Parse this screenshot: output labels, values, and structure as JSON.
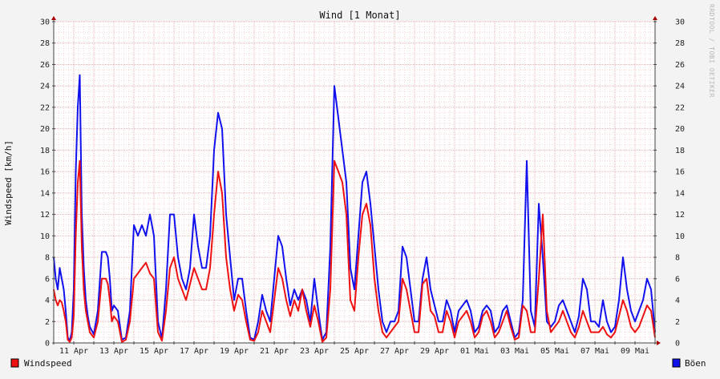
{
  "chart_data": {
    "type": "line",
    "title": "Wind [1 Monat]",
    "ylabel": "Windspeed [km/h]",
    "ylim": [
      0,
      30
    ],
    "y_ticks": [
      0,
      2,
      4,
      6,
      8,
      10,
      12,
      14,
      16,
      18,
      20,
      22,
      24,
      26,
      28,
      30
    ],
    "y_tick_labels": [
      "0",
      "2",
      "4",
      "6",
      "8",
      "10",
      "12",
      "14",
      "16",
      "18",
      "20",
      "22",
      "24",
      "26",
      "28",
      "30"
    ],
    "x_unit": "day",
    "xlim": [
      0,
      30
    ],
    "x_ticks": [
      1,
      3,
      5,
      7,
      9,
      11,
      13,
      15,
      17,
      19,
      21,
      23,
      25,
      27,
      29
    ],
    "x_tick_labels": [
      "11 Apr",
      "13 Apr",
      "15 Apr",
      "17 Apr",
      "19 Apr",
      "21 Apr",
      "23 Apr",
      "25 Apr",
      "27 Apr",
      "29 Apr",
      "01 Mai",
      "03 Mai",
      "05 Mai",
      "07 Mai",
      "09 Mai"
    ],
    "grid": true,
    "watermark": "RRDTOOL / TOBI OETIKER",
    "colors": {
      "windspeed": "#ee1111",
      "gusts": "#1111ee",
      "grid": "#e8a8a8",
      "background": "#ffffff"
    },
    "series": [
      {
        "name": "Windspeed",
        "color": "#ee1111",
        "x": [
          0,
          0.1,
          0.2,
          0.3,
          0.4,
          0.5,
          0.6,
          0.7,
          0.8,
          0.9,
          1.0,
          1.1,
          1.2,
          1.3,
          1.4,
          1.5,
          1.6,
          1.7,
          1.8,
          2.0,
          2.2,
          2.4,
          2.6,
          2.7,
          2.8,
          2.9,
          3.0,
          3.2,
          3.4,
          3.6,
          3.8,
          4.0,
          4.2,
          4.4,
          4.6,
          4.8,
          5.0,
          5.2,
          5.4,
          5.6,
          5.8,
          6.0,
          6.2,
          6.4,
          6.6,
          6.8,
          7.0,
          7.2,
          7.4,
          7.6,
          7.8,
          8.0,
          8.2,
          8.4,
          8.6,
          8.8,
          9.0,
          9.2,
          9.4,
          9.6,
          9.8,
          10.0,
          10.2,
          10.4,
          10.6,
          10.8,
          11.0,
          11.2,
          11.4,
          11.6,
          11.8,
          12.0,
          12.2,
          12.4,
          12.6,
          12.8,
          13.0,
          13.2,
          13.4,
          13.6,
          13.8,
          14.0,
          14.2,
          14.4,
          14.6,
          14.8,
          15.0,
          15.2,
          15.4,
          15.6,
          15.8,
          16.0,
          16.2,
          16.4,
          16.6,
          16.8,
          17.0,
          17.2,
          17.4,
          17.6,
          17.8,
          18.0,
          18.2,
          18.4,
          18.6,
          18.8,
          19.0,
          19.2,
          19.4,
          19.6,
          19.8,
          20.0,
          20.2,
          20.4,
          20.6,
          20.8,
          21.0,
          21.2,
          21.4,
          21.6,
          21.8,
          22.0,
          22.2,
          22.4,
          22.6,
          22.8,
          23.0,
          23.2,
          23.4,
          23.6,
          23.8,
          24.0,
          24.2,
          24.4,
          24.6,
          24.8,
          25.0,
          25.2,
          25.4,
          25.6,
          25.8,
          26.0,
          26.2,
          26.4,
          26.6,
          26.8,
          27.0,
          27.2,
          27.4,
          27.6,
          27.8,
          28.0,
          28.2,
          28.4,
          28.6,
          28.8,
          29.0,
          29.2,
          29.4,
          29.6,
          29.8,
          30.0
        ],
        "values": [
          5,
          4,
          3.5,
          4,
          3.8,
          3,
          2,
          0.3,
          0.1,
          0.5,
          2.5,
          10,
          15,
          17,
          9,
          5,
          3,
          2,
          1,
          0.5,
          2,
          6,
          6,
          5.5,
          4,
          2,
          2.5,
          2,
          0.1,
          0.3,
          2,
          6,
          6.5,
          7,
          7.5,
          6.5,
          6,
          1,
          0.2,
          3,
          7,
          8,
          6,
          5,
          4,
          5.5,
          7,
          6,
          5,
          5,
          7,
          12,
          16,
          14,
          8,
          5,
          3,
          4.5,
          4,
          2,
          0.3,
          0.2,
          1,
          3,
          2,
          1,
          4,
          7,
          6,
          4,
          2.5,
          4,
          3,
          5,
          3,
          1.5,
          3.5,
          2,
          0.1,
          0.5,
          5,
          17,
          16,
          15,
          12,
          4,
          3,
          8,
          12,
          13,
          11,
          6,
          3,
          1,
          0.5,
          1,
          1.5,
          2,
          6,
          5,
          3,
          1,
          1,
          5.5,
          6,
          3,
          2.5,
          1,
          1,
          3,
          2,
          0.5,
          2,
          2.5,
          3,
          2,
          0.5,
          1,
          2.5,
          3,
          2,
          0.5,
          1,
          2,
          3,
          1.5,
          0.3,
          0.5,
          3.5,
          3,
          1,
          1,
          6,
          12,
          3,
          1,
          1.5,
          2,
          3,
          2,
          1,
          0.5,
          1.5,
          3,
          2,
          1,
          1,
          1,
          1.5,
          0.8,
          0.5,
          1,
          2.5,
          4,
          3,
          1.5,
          1,
          1.5,
          2.5,
          3.5,
          3,
          0.5
        ]
      },
      {
        "name": "Böen",
        "color": "#1111ee",
        "x": [
          0,
          0.1,
          0.2,
          0.3,
          0.4,
          0.5,
          0.6,
          0.7,
          0.8,
          0.9,
          1.0,
          1.1,
          1.2,
          1.3,
          1.4,
          1.5,
          1.6,
          1.7,
          1.8,
          2.0,
          2.2,
          2.4,
          2.6,
          2.7,
          2.8,
          2.9,
          3.0,
          3.2,
          3.4,
          3.6,
          3.8,
          4.0,
          4.2,
          4.4,
          4.6,
          4.8,
          5.0,
          5.2,
          5.4,
          5.6,
          5.8,
          6.0,
          6.2,
          6.4,
          6.6,
          6.8,
          7.0,
          7.2,
          7.4,
          7.6,
          7.8,
          8.0,
          8.2,
          8.4,
          8.6,
          8.8,
          9.0,
          9.2,
          9.4,
          9.6,
          9.8,
          10.0,
          10.2,
          10.4,
          10.6,
          10.8,
          11.0,
          11.2,
          11.4,
          11.6,
          11.8,
          12.0,
          12.2,
          12.4,
          12.6,
          12.8,
          13.0,
          13.2,
          13.4,
          13.6,
          13.8,
          14.0,
          14.2,
          14.4,
          14.6,
          14.8,
          15.0,
          15.2,
          15.4,
          15.6,
          15.8,
          16.0,
          16.2,
          16.4,
          16.6,
          16.8,
          17.0,
          17.2,
          17.4,
          17.6,
          17.8,
          18.0,
          18.2,
          18.4,
          18.6,
          18.8,
          19.0,
          19.2,
          19.4,
          19.6,
          19.8,
          20.0,
          20.2,
          20.4,
          20.6,
          20.8,
          21.0,
          21.2,
          21.4,
          21.6,
          21.8,
          22.0,
          22.2,
          22.4,
          22.6,
          22.8,
          23.0,
          23.2,
          23.4,
          23.6,
          23.8,
          24.0,
          24.2,
          24.4,
          24.6,
          24.8,
          25.0,
          25.2,
          25.4,
          25.6,
          25.8,
          26.0,
          26.2,
          26.4,
          26.6,
          26.8,
          27.0,
          27.2,
          27.4,
          27.6,
          27.8,
          28.0,
          28.2,
          28.4,
          28.6,
          28.8,
          29.0,
          29.2,
          29.4,
          29.6,
          29.8,
          30.0
        ],
        "values": [
          8,
          6,
          5,
          7,
          6,
          5,
          3,
          0.5,
          0.2,
          1,
          5,
          16,
          22,
          25,
          12,
          7,
          4,
          2.5,
          1.5,
          0.8,
          3,
          8.5,
          8.5,
          8,
          6,
          3,
          3.5,
          3,
          0.3,
          0.5,
          3,
          11,
          10,
          11,
          10,
          12,
          10,
          2,
          0.4,
          5,
          12,
          12,
          8,
          6,
          5,
          7,
          12,
          9,
          7,
          7,
          10,
          18,
          21.5,
          20,
          12,
          8,
          4,
          6,
          6,
          3,
          0.5,
          0.3,
          2,
          4.5,
          3,
          2,
          6,
          10,
          9,
          6,
          3.5,
          5,
          4,
          5,
          4,
          2,
          6,
          3,
          0.3,
          1,
          9,
          24,
          21,
          18,
          15,
          7,
          5,
          10,
          15,
          16,
          13,
          9,
          5,
          2,
          1,
          2,
          2,
          3,
          9,
          8,
          5,
          2,
          2,
          6,
          8,
          5,
          3.5,
          2,
          2,
          4,
          3,
          1,
          3,
          3.5,
          4,
          3,
          1,
          1.5,
          3,
          3.5,
          3,
          1,
          1.5,
          3,
          3.5,
          2,
          0.5,
          1,
          4,
          17,
          3,
          1.5,
          13,
          8,
          2,
          1.5,
          2,
          3.5,
          4,
          3,
          2,
          1,
          2.5,
          6,
          5,
          2,
          2,
          1.5,
          4,
          2,
          1,
          1.5,
          4,
          8,
          5,
          3,
          2,
          3,
          4,
          6,
          5,
          1
        ]
      }
    ]
  },
  "legend": {
    "windspeed": {
      "label": "Windspeed",
      "color": "#ee1111"
    },
    "gusts": {
      "label": "Böen",
      "color": "#1111ee"
    }
  }
}
